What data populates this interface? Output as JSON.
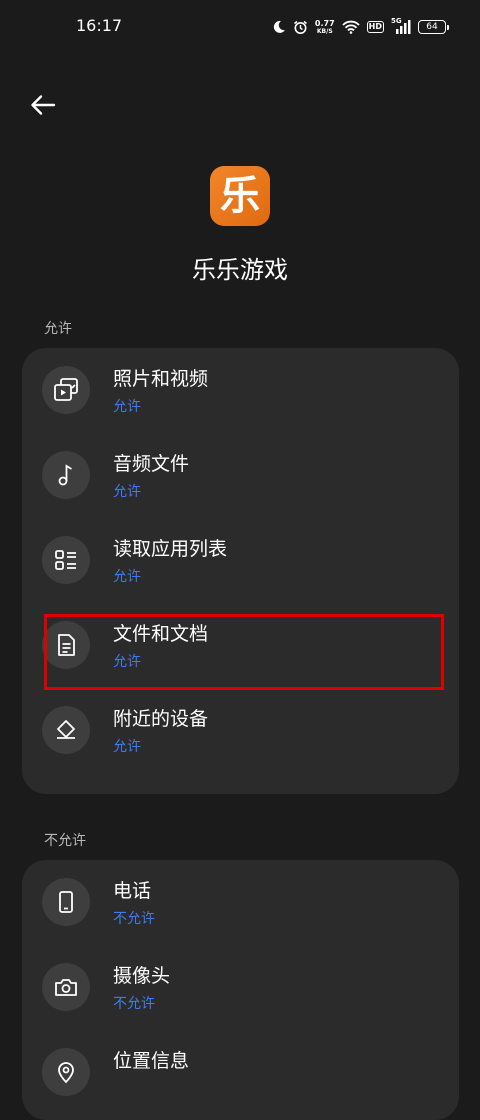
{
  "status_bar": {
    "time": "16:17",
    "speed_value": "0.77",
    "speed_unit": "KB/S",
    "hd": "HD",
    "network": "5G",
    "battery": "64"
  },
  "app": {
    "name": "乐乐游戏",
    "icon_glyph": "乐"
  },
  "allowed": {
    "header": "允许",
    "items": [
      {
        "title": "照片和视频",
        "status": "允许",
        "icon": "photo-video-icon"
      },
      {
        "title": "音频文件",
        "status": "允许",
        "icon": "music-note-icon"
      },
      {
        "title": "读取应用列表",
        "status": "允许",
        "icon": "app-list-icon"
      },
      {
        "title": "文件和文档",
        "status": "允许",
        "icon": "document-icon"
      },
      {
        "title": "附近的设备",
        "status": "允许",
        "icon": "nearby-devices-icon"
      }
    ]
  },
  "denied": {
    "header": "不允许",
    "items": [
      {
        "title": "电话",
        "status": "不允许",
        "icon": "phone-icon"
      },
      {
        "title": "摄像头",
        "status": "不允许",
        "icon": "camera-icon"
      },
      {
        "title": "位置信息",
        "status": "",
        "icon": "location-icon"
      }
    ]
  },
  "colors": {
    "background": "#1b1b1b",
    "card": "#2b2b2b",
    "accent": "#3d7cf0",
    "highlight": "#e00000",
    "app_icon": "#ee7a1f"
  }
}
